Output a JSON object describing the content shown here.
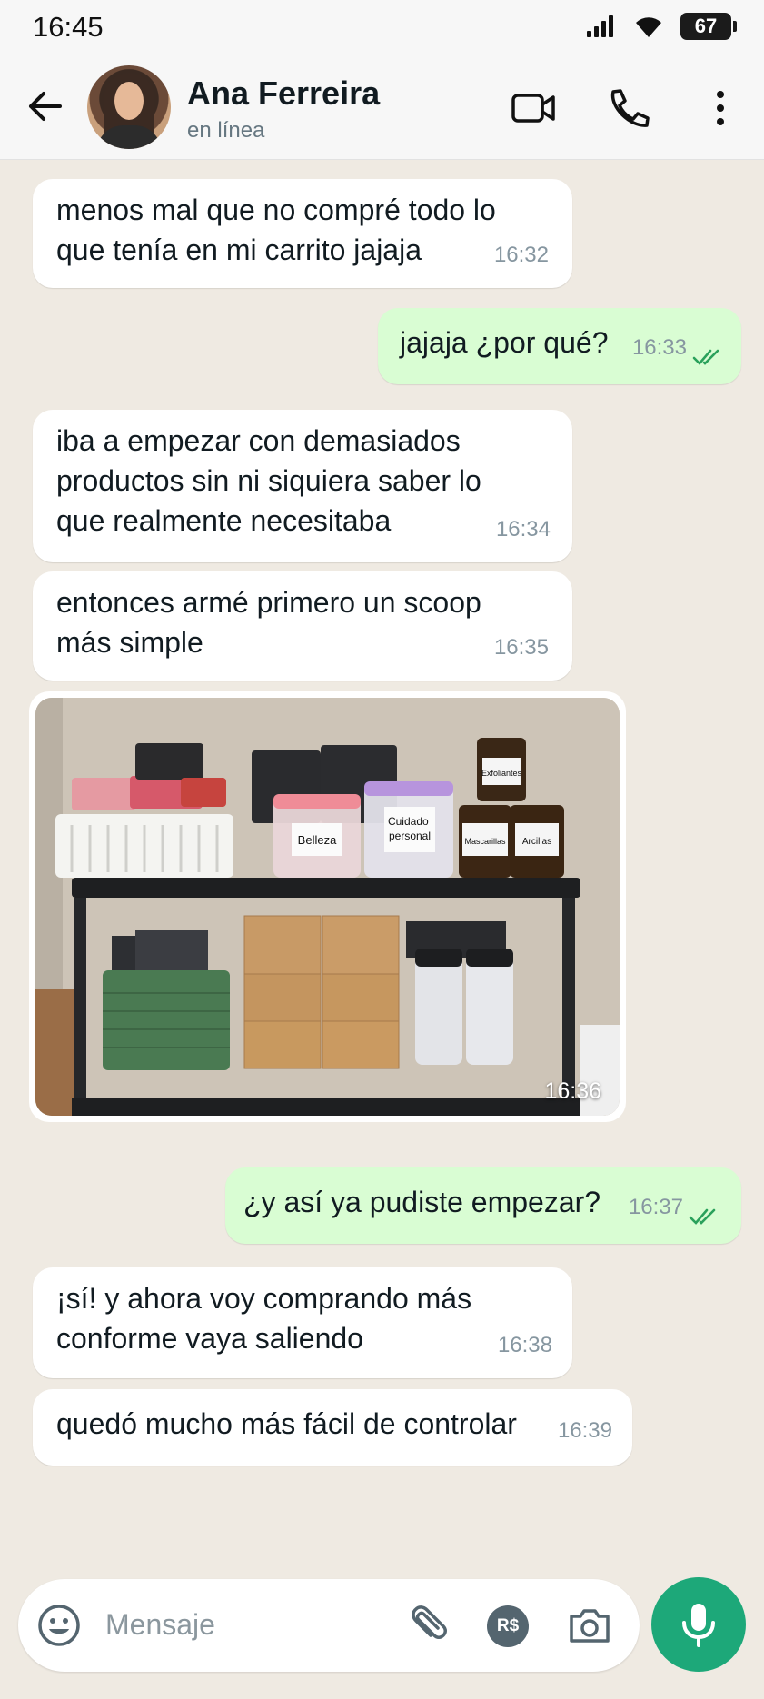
{
  "status_bar": {
    "time": "16:45",
    "battery": "67"
  },
  "header": {
    "contact_name": "Ana Ferreira",
    "contact_status": "en línea",
    "icons": [
      "back-arrow-icon",
      "video-call-icon",
      "phone-icon",
      "more-vert-icon"
    ]
  },
  "messages": [
    {
      "direction": "in",
      "lines": [
        "menos mal que no compré todo lo",
        "que tenía en mi carrito jajaja"
      ],
      "time": "16:32"
    },
    {
      "direction": "out",
      "lines": [
        "jajaja ¿por qué?"
      ],
      "time": "16:33",
      "read": true
    },
    {
      "direction": "in",
      "lines": [
        "iba a empezar con demasiados",
        "productos sin ni siquiera saber lo",
        "que realmente necesitaba"
      ],
      "time": "16:34"
    },
    {
      "direction": "in",
      "lines": [
        "entonces armé primero un scoop",
        "más simple"
      ],
      "time": "16:35"
    },
    {
      "direction": "in",
      "type": "image",
      "time": "16:36",
      "photo_labels": {
        "box1": "Belleza",
        "box2": "Cuidado personal",
        "jar1": "Exfoliantes",
        "jar2": "Mascarillas",
        "jar3": "Arcillas"
      }
    },
    {
      "direction": "out",
      "lines": [
        "¿y así ya pudiste empezar?"
      ],
      "time": "16:37",
      "read": true
    },
    {
      "direction": "in",
      "lines": [
        "¡sí! y ahora voy comprando más",
        "conforme vaya saliendo"
      ],
      "time": "16:38"
    },
    {
      "direction": "in",
      "lines": [
        "quedó mucho más fácil de controlar"
      ],
      "time": "16:39"
    }
  ],
  "input": {
    "placeholder": "Mensaje",
    "payment_label": "R$"
  },
  "colors": {
    "incoming": "#ffffff",
    "outgoing": "#d9fdd3",
    "accent": "#1da879",
    "background": "#efeae2"
  }
}
